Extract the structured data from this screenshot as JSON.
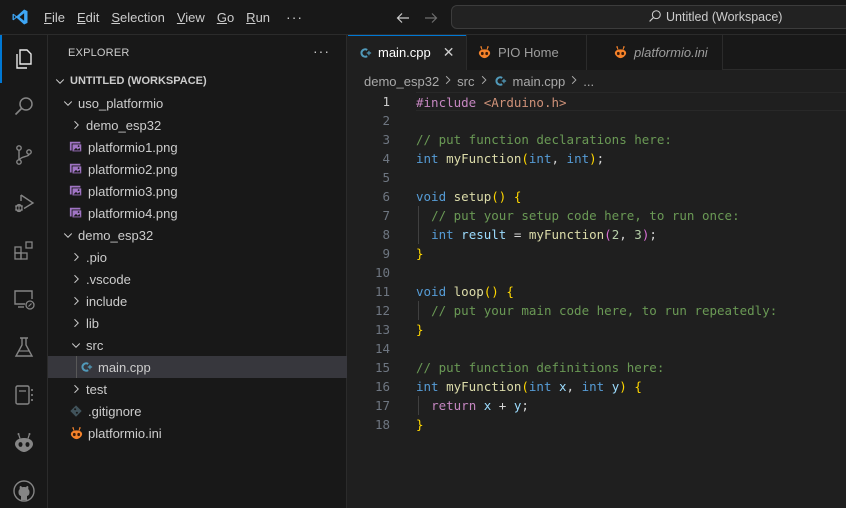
{
  "titlebar": {
    "menu": [
      {
        "label": "File",
        "mnemonic": "F",
        "rest": "ile"
      },
      {
        "label": "Edit",
        "mnemonic": "E",
        "rest": "dit"
      },
      {
        "label": "Selection",
        "mnemonic": "S",
        "rest": "election"
      },
      {
        "label": "View",
        "mnemonic": "V",
        "rest": "iew"
      },
      {
        "label": "Go",
        "mnemonic": "G",
        "rest": "o"
      },
      {
        "label": "Run",
        "mnemonic": "R",
        "rest": "un"
      }
    ],
    "more": "···",
    "command_center": "Untitled (Workspace)"
  },
  "activity_bar": {
    "items": [
      "explorer",
      "search",
      "source-control",
      "run-debug",
      "extensions",
      "remote-explorer",
      "testing",
      "notebook",
      "platformio",
      "github"
    ],
    "active": "explorer"
  },
  "sidebar": {
    "title": "EXPLORER",
    "actions": "···",
    "tree": [
      {
        "label": "UNTITLED (WORKSPACE)",
        "type": "workspace",
        "expanded": true,
        "depth": 0
      },
      {
        "label": "uso_platformio",
        "type": "folder",
        "expanded": true,
        "depth": 1
      },
      {
        "label": "demo_esp32",
        "type": "folder",
        "expanded": false,
        "depth": 2
      },
      {
        "label": "platformio1.png",
        "type": "image",
        "depth": 2
      },
      {
        "label": "platformio2.png",
        "type": "image",
        "depth": 2
      },
      {
        "label": "platformio3.png",
        "type": "image",
        "depth": 2
      },
      {
        "label": "platformio4.png",
        "type": "image",
        "depth": 2
      },
      {
        "label": "demo_esp32",
        "type": "folder",
        "expanded": true,
        "depth": 1
      },
      {
        "label": ".pio",
        "type": "folder",
        "expanded": false,
        "depth": 2
      },
      {
        "label": ".vscode",
        "type": "folder",
        "expanded": false,
        "depth": 2
      },
      {
        "label": "include",
        "type": "folder",
        "expanded": false,
        "depth": 2
      },
      {
        "label": "lib",
        "type": "folder",
        "expanded": false,
        "depth": 2
      },
      {
        "label": "src",
        "type": "folder",
        "expanded": true,
        "depth": 2
      },
      {
        "label": "main.cpp",
        "type": "cpp",
        "depth": 3,
        "selected": true
      },
      {
        "label": "test",
        "type": "folder",
        "expanded": false,
        "depth": 2
      },
      {
        "label": ".gitignore",
        "type": "git",
        "depth": 2
      },
      {
        "label": "platformio.ini",
        "type": "pio",
        "depth": 2
      }
    ]
  },
  "editor": {
    "tabs": [
      {
        "label": "main.cpp",
        "icon": "cpp",
        "active": true,
        "closable": true,
        "italic": false
      },
      {
        "label": "PIO Home",
        "icon": "pio",
        "active": false,
        "italic": false
      },
      {
        "label": "platformio.ini",
        "icon": "pio",
        "active": false,
        "italic": true
      }
    ],
    "breadcrumbs": [
      "demo_esp32",
      "src",
      "main.cpp",
      "..."
    ],
    "current_line": 1,
    "lines": [
      {
        "n": "1",
        "tokens": [
          [
            "t-ctrl",
            "#include"
          ],
          [
            "t-plain",
            " "
          ],
          [
            "t-str",
            "<Arduino.h>"
          ]
        ]
      },
      {
        "n": "2",
        "tokens": []
      },
      {
        "n": "3",
        "tokens": [
          [
            "t-cmt",
            "// put function declarations here:"
          ]
        ]
      },
      {
        "n": "4",
        "tokens": [
          [
            "t-kw",
            "int"
          ],
          [
            "t-plain",
            " "
          ],
          [
            "t-fn",
            "myFunction"
          ],
          [
            "t-br1",
            "("
          ],
          [
            "t-kw",
            "int"
          ],
          [
            "t-plain",
            ", "
          ],
          [
            "t-kw",
            "int"
          ],
          [
            "t-br1",
            ")"
          ],
          [
            "t-plain",
            ";"
          ]
        ]
      },
      {
        "n": "5",
        "tokens": []
      },
      {
        "n": "6",
        "tokens": [
          [
            "t-kw",
            "void"
          ],
          [
            "t-plain",
            " "
          ],
          [
            "t-fn",
            "setup"
          ],
          [
            "t-br1",
            "()"
          ],
          [
            "t-plain",
            " "
          ],
          [
            "t-br1",
            "{"
          ]
        ]
      },
      {
        "n": "7",
        "guide": true,
        "tokens": [
          [
            "t-plain",
            "  "
          ],
          [
            "t-cmt",
            "// put your setup code here, to run once:"
          ]
        ]
      },
      {
        "n": "8",
        "guide": true,
        "tokens": [
          [
            "t-plain",
            "  "
          ],
          [
            "t-kw",
            "int"
          ],
          [
            "t-plain",
            " "
          ],
          [
            "t-var",
            "result"
          ],
          [
            "t-plain",
            " = "
          ],
          [
            "t-fn",
            "myFunction"
          ],
          [
            "t-br2",
            "("
          ],
          [
            "t-num",
            "2"
          ],
          [
            "t-plain",
            ", "
          ],
          [
            "t-num",
            "3"
          ],
          [
            "t-br2",
            ")"
          ],
          [
            "t-plain",
            ";"
          ]
        ]
      },
      {
        "n": "9",
        "tokens": [
          [
            "t-br1",
            "}"
          ]
        ]
      },
      {
        "n": "10",
        "tokens": []
      },
      {
        "n": "11",
        "tokens": [
          [
            "t-kw",
            "void"
          ],
          [
            "t-plain",
            " "
          ],
          [
            "t-fn",
            "loop"
          ],
          [
            "t-br1",
            "()"
          ],
          [
            "t-plain",
            " "
          ],
          [
            "t-br1",
            "{"
          ]
        ]
      },
      {
        "n": "12",
        "guide": true,
        "tokens": [
          [
            "t-plain",
            "  "
          ],
          [
            "t-cmt",
            "// put your main code here, to run repeatedly:"
          ]
        ]
      },
      {
        "n": "13",
        "tokens": [
          [
            "t-br1",
            "}"
          ]
        ]
      },
      {
        "n": "14",
        "tokens": []
      },
      {
        "n": "15",
        "tokens": [
          [
            "t-cmt",
            "// put function definitions here:"
          ]
        ]
      },
      {
        "n": "16",
        "tokens": [
          [
            "t-kw",
            "int"
          ],
          [
            "t-plain",
            " "
          ],
          [
            "t-fn",
            "myFunction"
          ],
          [
            "t-br1",
            "("
          ],
          [
            "t-kw",
            "int"
          ],
          [
            "t-plain",
            " "
          ],
          [
            "t-var",
            "x"
          ],
          [
            "t-plain",
            ", "
          ],
          [
            "t-kw",
            "int"
          ],
          [
            "t-plain",
            " "
          ],
          [
            "t-var",
            "y"
          ],
          [
            "t-br1",
            ")"
          ],
          [
            "t-plain",
            " "
          ],
          [
            "t-br1",
            "{"
          ]
        ]
      },
      {
        "n": "17",
        "guide": true,
        "tokens": [
          [
            "t-plain",
            "  "
          ],
          [
            "t-ctrl",
            "return"
          ],
          [
            "t-plain",
            " "
          ],
          [
            "t-var",
            "x"
          ],
          [
            "t-plain",
            " + "
          ],
          [
            "t-var",
            "y"
          ],
          [
            "t-plain",
            ";"
          ]
        ]
      },
      {
        "n": "18",
        "tokens": [
          [
            "t-br1",
            "}"
          ]
        ]
      }
    ]
  },
  "colors": {
    "accent": "#0078d4",
    "cpp_icon": "#519aba",
    "image_icon": "#a074c4",
    "pio_icon": "#f5822a"
  }
}
